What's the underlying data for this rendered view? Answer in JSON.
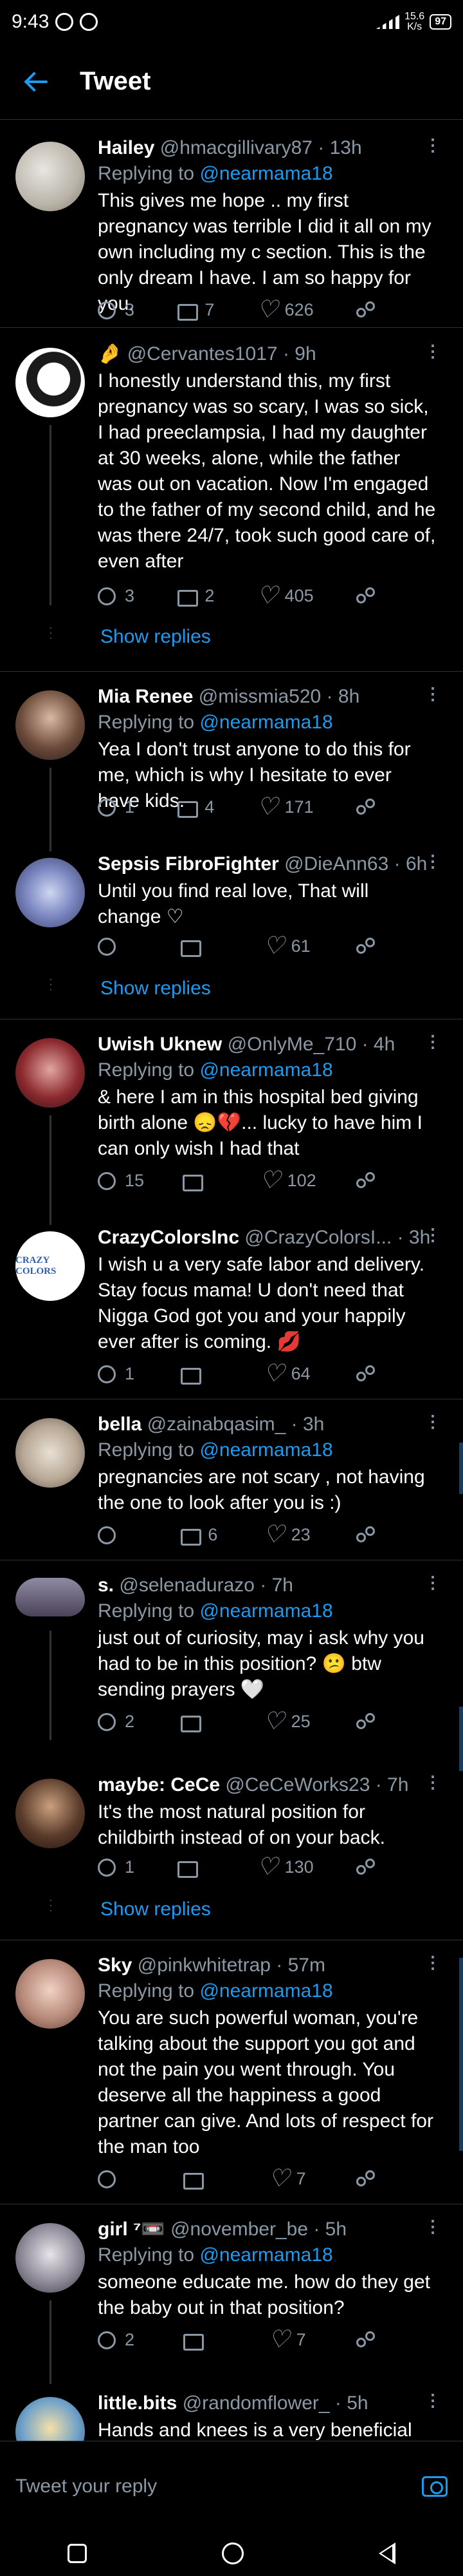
{
  "status": {
    "time": "9:43",
    "speed_top": "15.6",
    "speed_bottom": "K/s",
    "battery": "97"
  },
  "header": {
    "title": "Tweet"
  },
  "tweets": [
    {
      "name": "Hailey",
      "handle": "@hmacgillivary87 · 13h",
      "replying_label": "Replying to",
      "replying_to": "@nearmama18",
      "text": "This gives me hope .. my first pregnancy was terrible I did it all on my own including my c section. This is the only dream I have. I am so happy for you.",
      "replies": "3",
      "retweets": "7",
      "likes": "626"
    },
    {
      "name": "",
      "handle": "🤌 @Cervantes1017 · 9h",
      "text": "I honestly understand this, my first pregnancy was so scary, I was so sick, I had preeclampsia, I had my daughter at 30 weeks, alone, while the father was out on vacation. Now I'm engaged to the father of my second child, and he was there 24/7, took such good care of, even after",
      "replies": "3",
      "retweets": "2",
      "likes": "405",
      "show_replies": "Show replies"
    },
    {
      "name": "Mia Renee",
      "handle": "@missmia520 · 8h",
      "replying_label": "Replying to",
      "replying_to": "@nearmama18",
      "text": "Yea I don't trust anyone to do this for me, which is why I hesitate to ever have kids.",
      "replies": "1",
      "retweets": "4",
      "likes": "171"
    },
    {
      "name": "Sepsis FibroFighter",
      "handle": "@DieAnn63 · 6h",
      "text": "Until you find real love, That will change ♡",
      "likes": "61",
      "show_replies": "Show replies"
    },
    {
      "name": "Uwish Uknew",
      "handle": "@OnlyMe_710 · 4h",
      "replying_label": "Replying to",
      "replying_to": "@nearmama18",
      "text": "& here I am in this hospital bed giving birth alone 😞💔... lucky to have him I can only wish I had that",
      "replies": "15",
      "likes": "102"
    },
    {
      "name": "CrazyColorsInc",
      "handle": "@CrazyColorsI... · 3h",
      "text": "I wish u a very safe labor and delivery. Stay focus mama! U don't need that Nigga God got you and your happily ever after is coming. 💋",
      "replies": "1",
      "likes": "64"
    },
    {
      "name": "bella",
      "handle": "@zainabqasim_ · 3h",
      "replying_label": "Replying to",
      "replying_to": "@nearmama18",
      "text": "pregnancies are not scary , not having the one to look after you is :)",
      "retweets": "6",
      "likes": "23"
    },
    {
      "name": "s.",
      "handle": "@selenadurazo · 7h",
      "replying_label": "Replying to",
      "replying_to": "@nearmama18",
      "text": "just out of curiosity, may i ask why you had to be in this position? 😕 btw sending prayers 🤍",
      "replies": "2",
      "likes": "25"
    },
    {
      "name": "maybe: CeCe",
      "handle": "@CeCeWorks23 · 7h",
      "text": "It's the most natural position for childbirth instead of on your back.",
      "replies": "1",
      "likes": "130",
      "show_replies": "Show replies"
    },
    {
      "name": "Sky",
      "handle": "@pinkwhitetrap · 57m",
      "replying_label": "Replying to",
      "replying_to": "@nearmama18",
      "text": "You are such powerful woman, you're talking about the support you got and not the pain you went through. You deserve all the happiness a good partner can give. And lots of respect for the man too",
      "likes": "7"
    },
    {
      "name": "girl ⁷📼",
      "handle": "@november_be · 5h",
      "replying_label": "Replying to",
      "replying_to": "@nearmama18",
      "text": "someone educate me. how do they get the baby out in that position?",
      "replies": "2",
      "likes": "7"
    },
    {
      "name": "little.bits",
      "handle": "@randomflower_ · 5h",
      "text": "Hands and knees is a very beneficial"
    }
  ],
  "composer": {
    "placeholder": "Tweet your reply"
  },
  "colors": {
    "accent": "#1d9bf0",
    "background": "#000000",
    "muted": "#8b98a5"
  }
}
